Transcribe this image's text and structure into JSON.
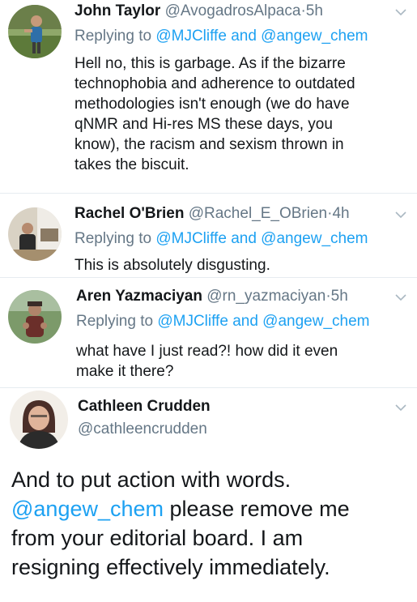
{
  "tweets": [
    {
      "name": "John Taylor",
      "handle": "@AvogadrosAlpaca",
      "time": "5h",
      "replying_prefix": "Replying to",
      "replying_to_1": "@MJCliffe",
      "replying_and": "and",
      "replying_to_2": "@angew_chem",
      "text": "Hell no, this is garbage. As if the bizarre\ntechnophobia and adherence to outdated\nmethodologies isn't enough (we do have\nqNMR and Hi-res MS these days, you\nknow), the racism and sexism thrown in\ntakes the biscuit."
    },
    {
      "name": "Rachel O'Brien",
      "handle": "@Rachel_E_OBrien",
      "time": "4h",
      "replying_prefix": "Replying to",
      "replying_to_1": "@MJCliffe",
      "replying_and": "and",
      "replying_to_2": "@angew_chem",
      "text": "This is absolutely disgusting."
    },
    {
      "name": "Aren Yazmaciyan",
      "handle": "@rn_yazmaciyan",
      "time": "5h",
      "replying_prefix": "Replying to",
      "replying_to_1": "@MJCliffe",
      "replying_and": "and",
      "replying_to_2": "@angew_chem",
      "text": "what have I just read?! how did it even\nmake it there?"
    }
  ],
  "main_tweet": {
    "name": "Cathleen Crudden",
    "handle": "@cathleencrudden",
    "line1": "And to put action with words.",
    "mention": "@angew_chem",
    "line2_rest": " please remove me",
    "line3": "from your editorial board. I am",
    "line4": "resigning effectively immediately."
  },
  "separator": "·",
  "icons": {
    "more": "chevron-down-icon"
  },
  "colors": {
    "link": "#1da1f2",
    "secondary_text": "#657786",
    "text": "#14171a"
  }
}
